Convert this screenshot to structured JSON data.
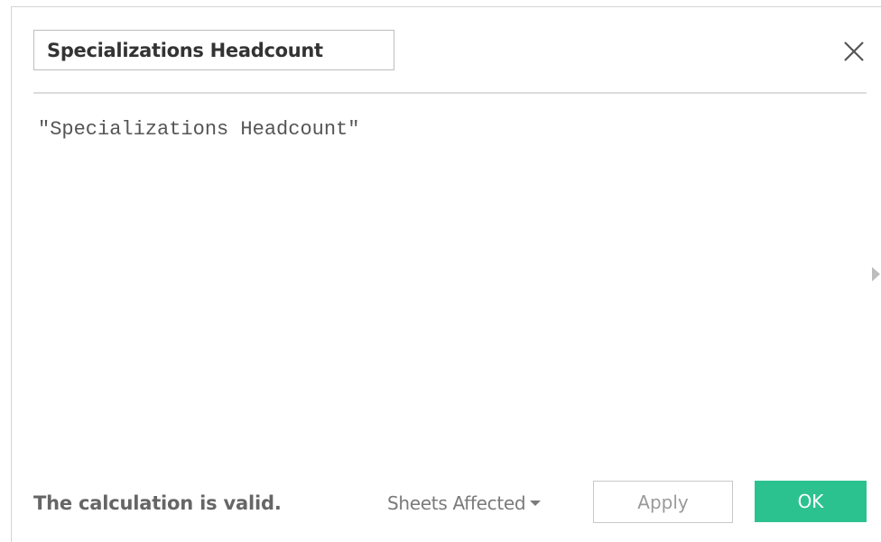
{
  "dialog": {
    "calculation_name": "Specializations Headcount",
    "close_icon": "close-icon"
  },
  "editor": {
    "formula": "\"Specializations Headcount\"",
    "expand_icon": "triangle-right-icon"
  },
  "footer": {
    "status": "The calculation is valid.",
    "sheets_affected_label": "Sheets Affected",
    "sheets_affected_icon": "caret-down-icon",
    "apply_label": "Apply",
    "ok_label": "OK"
  },
  "colors": {
    "ok_button": "#2cc28f",
    "divider": "#dcdcdc"
  }
}
